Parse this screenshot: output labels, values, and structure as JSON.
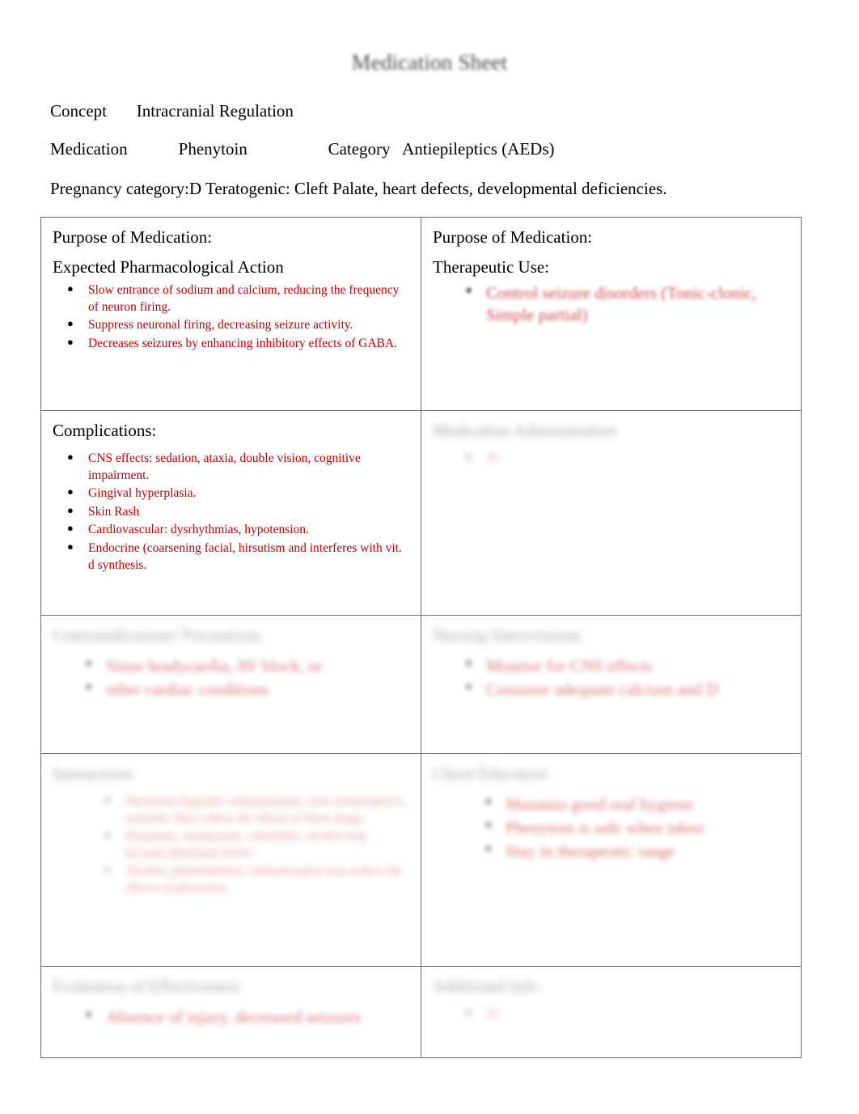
{
  "document": {
    "title": "Medication Sheet",
    "fields": [
      {
        "label": "Concept",
        "value": "Intracranial Regulation"
      }
    ],
    "medication_label": "Medication",
    "medication_value": "Phenytoin",
    "category_label": "Category",
    "category_value": "Antiepileptics (AEDs)",
    "pregnancy_line": "Pregnancy category:D Teratogenic: Cleft Palate, heart defects, developmental deficiencies."
  },
  "grid": {
    "r1c1": {
      "title": "Purpose of Medication:",
      "subtitle": "Expected Pharmacological Action",
      "bullets": [
        "Slow entrance of sodium and calcium, reducing the frequency of neuron firing.",
        "Suppress neuronal firing, decreasing seizure activity.",
        "Decreases seizures by enhancing inhibitory effects of GABA."
      ]
    },
    "r1c2": {
      "title": "Purpose of Medication:",
      "subtitle": "Therapeutic Use:",
      "bullets": [
        "Control seizure disorders (Tonic-clonic, Simple partial)"
      ]
    },
    "r2c1": {
      "title": "Complications:",
      "bullets": [
        "CNS effects: sedation, ataxia, double vision, cognitive impairment.",
        "Gingival hyperplasia.",
        "Skin Rash",
        "Cardiovascular: dysrhythmias, hypotension.",
        "Endocrine (coarsening facial, hirsutism and interferes with vit. d synthesis."
      ]
    },
    "r2c2": {
      "title": "Medication Administration",
      "bullets": [
        "IV"
      ]
    },
    "r3c1": {
      "title": "Contraindications/ Precautions",
      "bullets": [
        "Sinus bradycardia, AV block, or",
        "other cardiac conditions"
      ]
    },
    "r3c2": {
      "title": "Nursing Interventions",
      "bullets": [
        "Monitor for CNS effects",
        "Consume adequate calcium and D"
      ]
    },
    "r4c1": {
      "title": "Interactions",
      "bullets": [
        "Phenytoin degrades carbamazepine, oral contraceptives, warfarin. May reduce the effects of these drugs.",
        "Diazepam, omeprazole, cimetidine, alcohol may increase phenytoin levels.",
        "Alcohol, phenobarbital, carbamazepine may reduce the effects of phenytoin."
      ]
    },
    "r4c2": {
      "title": "Client Education",
      "bullets": [
        "Maintain good oral hygiene",
        "Phenytoin is safe when taken",
        "Stay in therapeutic range"
      ]
    },
    "r5c1": {
      "title": "Evaluation of Effectiveness",
      "bullets": [
        "Absence of injury, decreased seizures"
      ]
    },
    "r5c2": {
      "title": "Additional Info",
      "bullets": [
        "IV"
      ]
    }
  }
}
